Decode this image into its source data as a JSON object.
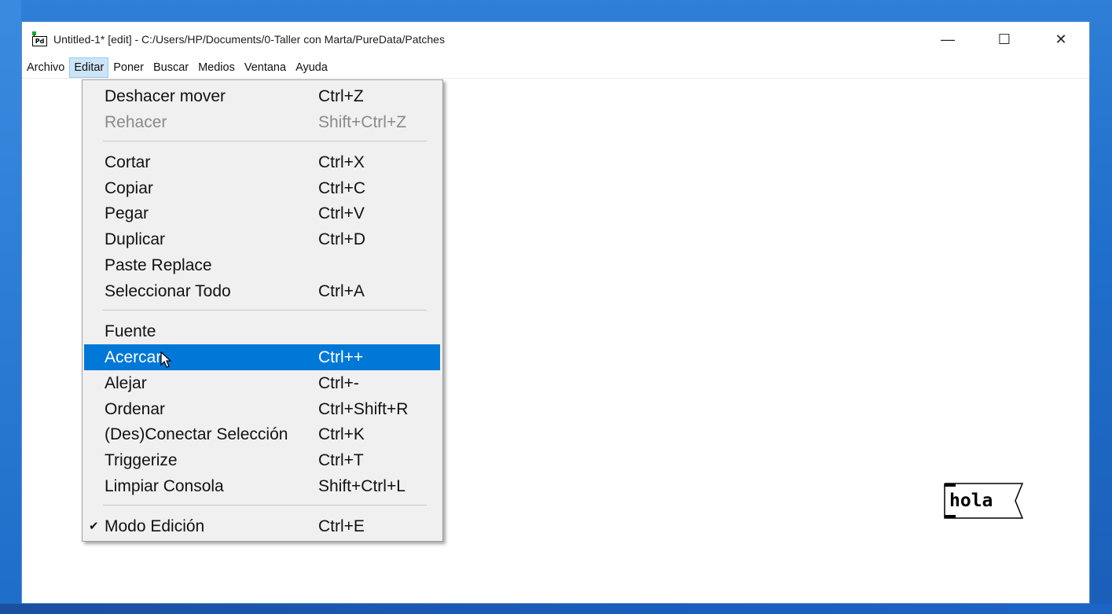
{
  "window": {
    "title": "Untitled-1* [edit] - C:/Users/HP/Documents/0-Taller con Marta/PureData/Patches",
    "app_icon_text": "Pd",
    "controls": {
      "minimize": "—",
      "maximize": "☐",
      "close": "✕"
    }
  },
  "menubar": {
    "items": [
      {
        "label": "Archivo"
      },
      {
        "label": "Editar"
      },
      {
        "label": "Poner"
      },
      {
        "label": "Buscar"
      },
      {
        "label": "Medios"
      },
      {
        "label": "Ventana"
      },
      {
        "label": "Ayuda"
      }
    ],
    "active": "Editar"
  },
  "edit_menu": {
    "items": [
      {
        "label": "Deshacer mover",
        "shortcut": "Ctrl+Z"
      },
      {
        "label": "Rehacer",
        "shortcut": "Shift+Ctrl+Z",
        "disabled": true
      },
      {
        "label": "Cortar",
        "shortcut": "Ctrl+X"
      },
      {
        "label": "Copiar",
        "shortcut": "Ctrl+C"
      },
      {
        "label": "Pegar",
        "shortcut": "Ctrl+V"
      },
      {
        "label": "Duplicar",
        "shortcut": "Ctrl+D"
      },
      {
        "label": "Paste Replace",
        "shortcut": ""
      },
      {
        "label": "Seleccionar Todo",
        "shortcut": "Ctrl+A"
      },
      {
        "label": "Fuente",
        "shortcut": ""
      },
      {
        "label": "Acercar",
        "shortcut": "Ctrl++",
        "highlighted": true
      },
      {
        "label": "Alejar",
        "shortcut": "Ctrl+-"
      },
      {
        "label": "Ordenar",
        "shortcut": "Ctrl+Shift+R"
      },
      {
        "label": "(Des)Conectar Selección",
        "shortcut": "Ctrl+K"
      },
      {
        "label": "Triggerize",
        "shortcut": "Ctrl+T"
      },
      {
        "label": "Limpiar Consola",
        "shortcut": "Shift+Ctrl+L"
      },
      {
        "label": "Modo Edición",
        "shortcut": "Ctrl+E",
        "checked": true,
        "check_glyph": "✔"
      }
    ]
  },
  "canvas": {
    "message_box": {
      "text": "hola"
    }
  },
  "colors": {
    "highlight": "#0078d7",
    "menu_bg": "#f0f0f0",
    "menubar_active_bg": "#cce4f7",
    "disabled_text": "#8a8a8a"
  }
}
